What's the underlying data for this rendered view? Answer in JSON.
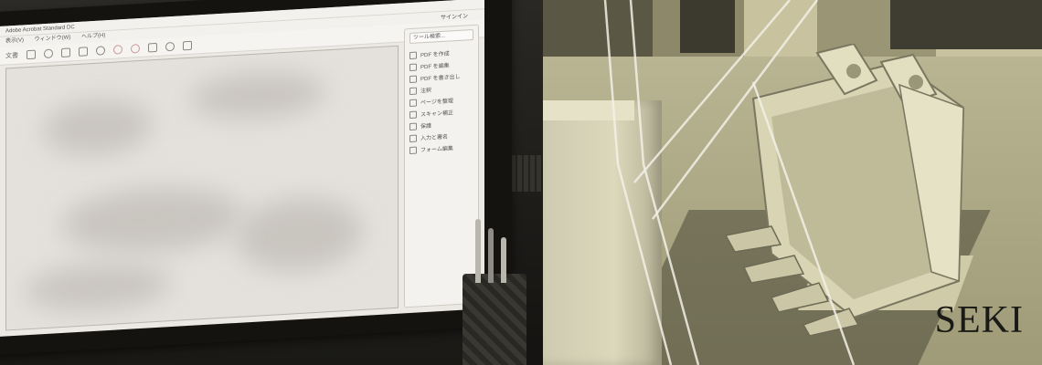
{
  "monitor_screen": {
    "app_title": "Adobe Acrobat Standard DC",
    "menu": [
      "表示(V)",
      "ウィンドウ(W)",
      "ヘルプ(H)"
    ],
    "tab_label": "文書",
    "signin_label": "サインイン",
    "tools_search": "ツール検索...",
    "tools": [
      {
        "label": "PDF を作成",
        "icon": "pdf-create-icon"
      },
      {
        "label": "PDF を編集",
        "icon": "pdf-edit-icon"
      },
      {
        "label": "PDF を書き出し",
        "icon": "pdf-export-icon"
      },
      {
        "label": "注釈",
        "icon": "comment-icon"
      },
      {
        "label": "ページを整理",
        "icon": "organize-pages-icon"
      },
      {
        "label": "スキャン補正",
        "icon": "scan-icon"
      },
      {
        "label": "保護",
        "icon": "protect-icon"
      },
      {
        "label": "入力と署名",
        "icon": "fill-sign-icon"
      },
      {
        "label": "フォーム編集",
        "icon": "form-icon"
      }
    ]
  },
  "brand": {
    "logo_text": "SEKI"
  },
  "colors": {
    "photo_tint": "#cdc9a8",
    "logo": "#1a1a16",
    "overlay_line": "#f2f0e6"
  }
}
